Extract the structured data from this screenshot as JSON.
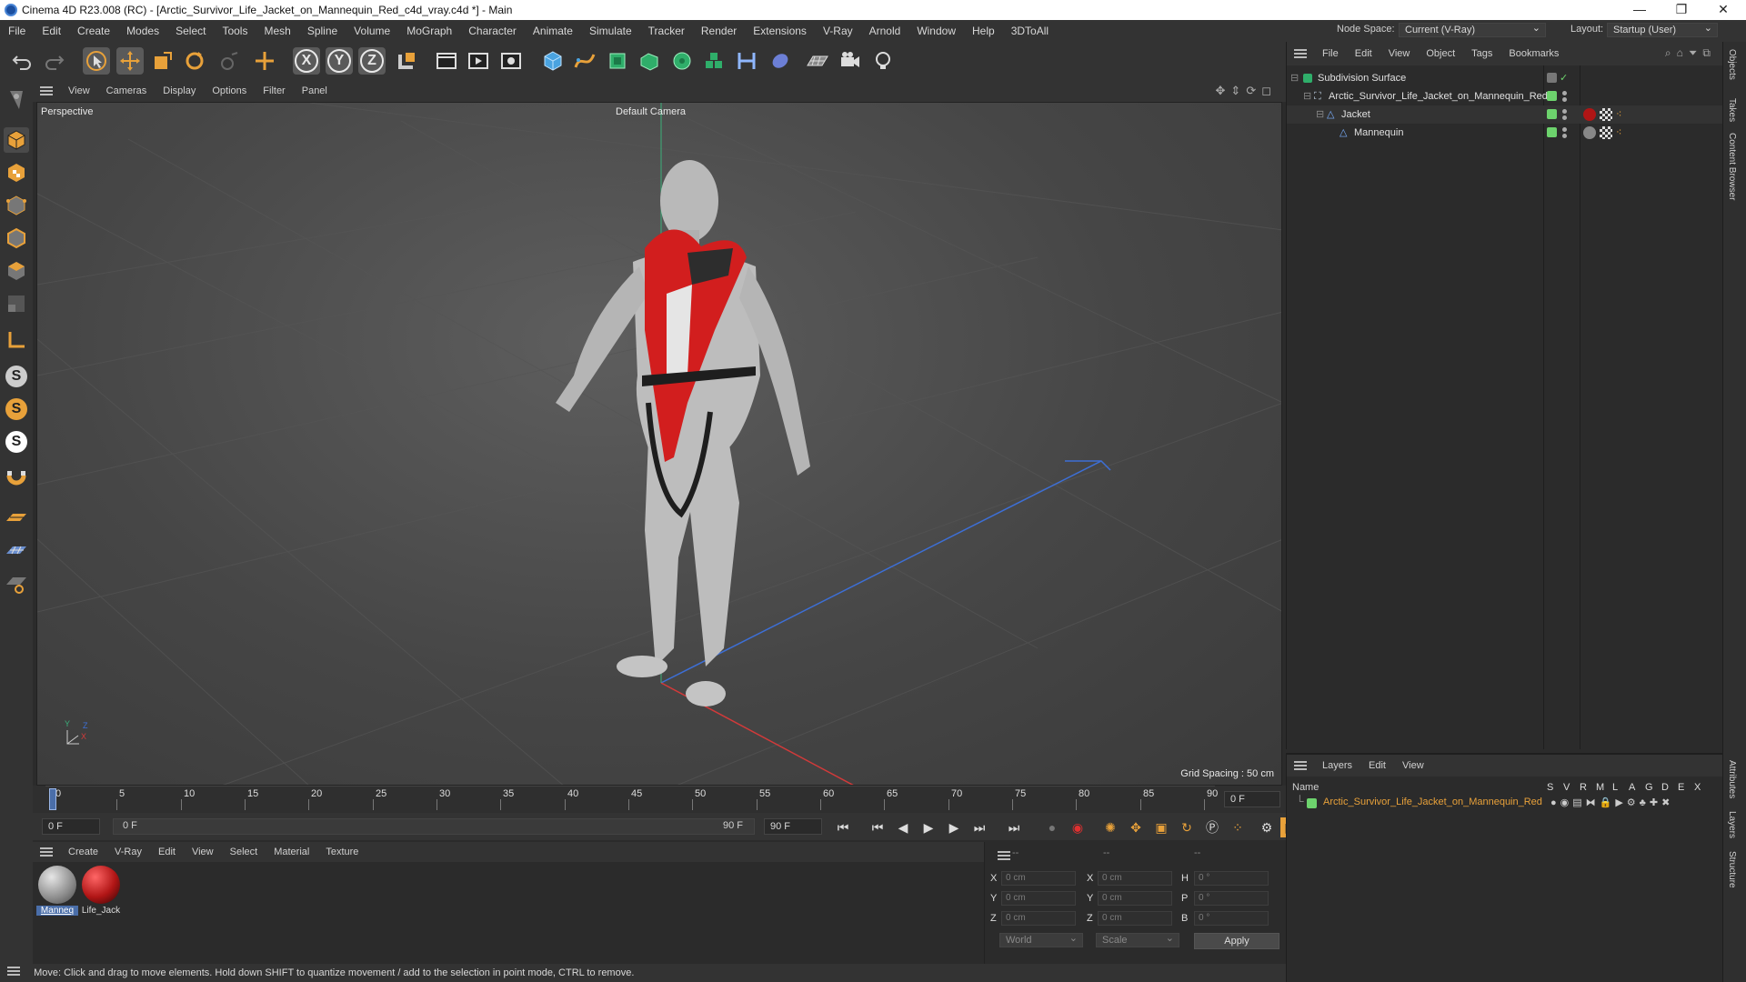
{
  "window": {
    "title": "Cinema 4D R23.008 (RC) - [Arctic_Survivor_Life_Jacket_on_Mannequin_Red_c4d_vray.c4d *] - Main",
    "minimize": "—",
    "maximize": "❐",
    "close": "✕"
  },
  "menubar": {
    "items": [
      "File",
      "Edit",
      "Create",
      "Modes",
      "Select",
      "Tools",
      "Mesh",
      "Spline",
      "Volume",
      "MoGraph",
      "Character",
      "Animate",
      "Simulate",
      "Tracker",
      "Render",
      "Extensions",
      "V-Ray",
      "Arnold",
      "Window",
      "Help",
      "3DToAll"
    ],
    "node_space_label": "Node Space:",
    "node_space_value": "Current (V-Ray)",
    "layout_label": "Layout:",
    "layout_value": "Startup (User)"
  },
  "viewport": {
    "menu": [
      "View",
      "Cameras",
      "Display",
      "Options",
      "Filter",
      "Panel"
    ],
    "label": "Perspective",
    "camera": "Default Camera",
    "grid_spacing": "Grid Spacing : 50 cm",
    "axis_x": "X",
    "axis_y": "Y",
    "axis_z": "Z"
  },
  "timeline": {
    "ticks": [
      "0",
      "5",
      "10",
      "15",
      "20",
      "25",
      "30",
      "35",
      "40",
      "45",
      "50",
      "55",
      "60",
      "65",
      "70",
      "75",
      "80",
      "85",
      "90"
    ],
    "current_frame": "0 F",
    "start_field": "0 F",
    "range_start": "0 F",
    "range_end": "90 F",
    "end_field": "90 F"
  },
  "materials": {
    "menu": [
      "Create",
      "V-Ray",
      "Edit",
      "View",
      "Select",
      "Material",
      "Texture"
    ],
    "items": [
      {
        "name": "Manneq",
        "color": "#9a9a9a"
      },
      {
        "name": "Life_Jack",
        "color": "#b01515"
      }
    ]
  },
  "coordinates": {
    "header": [
      "--",
      "--",
      "--"
    ],
    "rows": [
      {
        "a": "X",
        "a_val": "0 cm",
        "b": "X",
        "b_val": "0 cm",
        "c": "H",
        "c_val": "0 °"
      },
      {
        "a": "Y",
        "a_val": "0 cm",
        "b": "Y",
        "b_val": "0 cm",
        "c": "P",
        "c_val": "0 °"
      },
      {
        "a": "Z",
        "a_val": "0 cm",
        "b": "Z",
        "b_val": "0 cm",
        "c": "B",
        "c_val": "0 °"
      }
    ],
    "mode": "World",
    "scale": "Scale",
    "apply": "Apply"
  },
  "status": "Move: Click and drag to move elements. Hold down SHIFT to quantize movement / add to the selection in point mode, CTRL to remove.",
  "objects": {
    "menu": [
      "File",
      "Edit",
      "View",
      "Object",
      "Tags",
      "Bookmarks"
    ],
    "rows": [
      {
        "name": "Subdivision Surface"
      },
      {
        "name": "Arctic_Survivor_Life_Jacket_on_Mannequin_Red"
      },
      {
        "name": "Jacket"
      },
      {
        "name": "Mannequin"
      }
    ]
  },
  "layers": {
    "menu": [
      "Layers",
      "Edit",
      "View"
    ],
    "name_header": "Name",
    "flags": [
      "S",
      "V",
      "R",
      "M",
      "L",
      "A",
      "G",
      "D",
      "E",
      "X"
    ],
    "row": "Arctic_Survivor_Life_Jacket_on_Mannequin_Red",
    "row_color": "#e8a13a"
  },
  "right_tabs": [
    "Objects",
    "Takes",
    "Content Browser",
    "Attributes",
    "Layers",
    "Structure"
  ]
}
